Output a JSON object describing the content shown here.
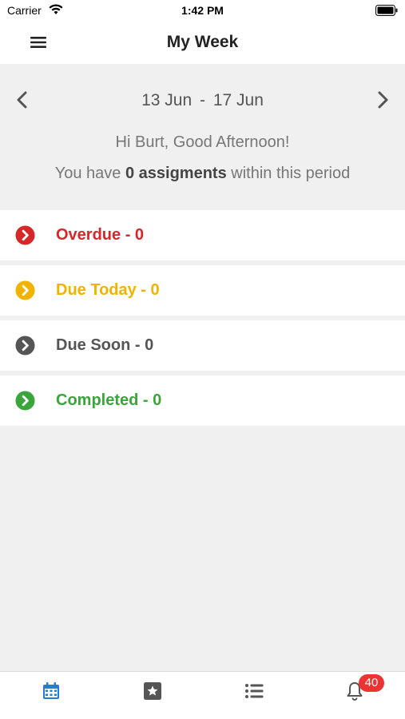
{
  "status_bar": {
    "carrier": "Carrier",
    "time": "1:42 PM"
  },
  "nav": {
    "title": "My Week",
    "menu_icon": "hamburger-menu-icon"
  },
  "period": {
    "start": "13 Jun",
    "separator": "-",
    "end": "17 Jun",
    "greeting": "Hi Burt, Good Afternoon!",
    "assign_prefix": "You have ",
    "assign_count_text": "0 assigments",
    "assign_suffix": " within this period"
  },
  "statuses": [
    {
      "label": "Overdue -  0",
      "color": "#d62828",
      "icon": "chevron-right-circle-icon"
    },
    {
      "label": "Due Today -  0",
      "color": "#f0b400",
      "icon": "chevron-right-circle-icon"
    },
    {
      "label": "Due Soon -  0",
      "color": "#555555",
      "icon": "chevron-right-circle-icon"
    },
    {
      "label": "Completed -  0",
      "color": "#3aa53a",
      "icon": "chevron-right-circle-icon"
    }
  ],
  "tabs": [
    {
      "name": "calendar-icon",
      "active": true
    },
    {
      "name": "star-box-icon",
      "active": false
    },
    {
      "name": "list-icon",
      "active": false
    },
    {
      "name": "bell-icon",
      "active": false
    }
  ],
  "notifications_badge": "40",
  "colors": {
    "active_tab": "#1e7fd8",
    "inactive_tab": "#666666"
  }
}
